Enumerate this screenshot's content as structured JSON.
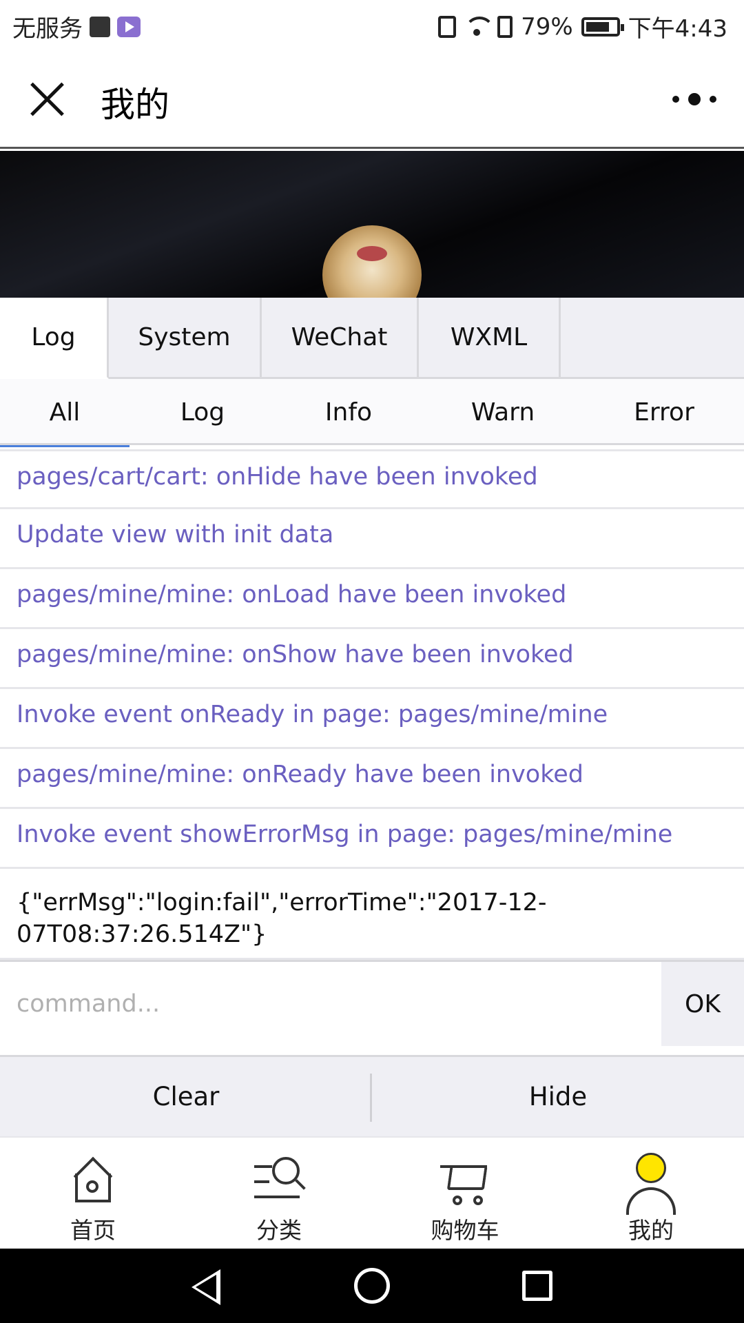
{
  "status_bar": {
    "carrier": "无服务",
    "battery": "79%",
    "battery_level": 0.79,
    "time": "下午4:43"
  },
  "header": {
    "title": "我的"
  },
  "debug_tabs": [
    "Log",
    "System",
    "WeChat",
    "WXML"
  ],
  "debug_subtabs": [
    "All",
    "Log",
    "Info",
    "Warn",
    "Error"
  ],
  "log_entries": [
    {
      "level": "info",
      "text": "pages/cart/cart: onHide have been invoked"
    },
    {
      "level": "info",
      "text": "Update view with init data"
    },
    {
      "level": "info",
      "text": "pages/mine/mine: onLoad have been invoked"
    },
    {
      "level": "info",
      "text": "pages/mine/mine: onShow have been invoked"
    },
    {
      "level": "info",
      "text": "Invoke event onReady in page: pages/mine/mine"
    },
    {
      "level": "info",
      "text": "pages/mine/mine: onReady have been invoked"
    },
    {
      "level": "info",
      "text": "Invoke event showErrorMsg in page: pages/mine/mine"
    },
    {
      "level": "log",
      "line1": "{\"errMsg\":\"login:fail\",\"errorTime\":\"2017-12-",
      "line2": "07T08:37:26.514Z\"}"
    }
  ],
  "command": {
    "placeholder": "command...",
    "value": "",
    "ok_label": "OK"
  },
  "actions": {
    "clear_label": "Clear",
    "hide_label": "Hide"
  },
  "tabbar": {
    "items": [
      {
        "label": "首页",
        "icon": "home-icon"
      },
      {
        "label": "分类",
        "icon": "category-search-icon"
      },
      {
        "label": "购物车",
        "icon": "cart-icon"
      },
      {
        "label": "我的",
        "icon": "user-icon"
      }
    ]
  },
  "colors": {
    "info_text": "#6a5fc0",
    "active_underline": "#4a7fdb",
    "user_icon_head": "#ffe500"
  }
}
